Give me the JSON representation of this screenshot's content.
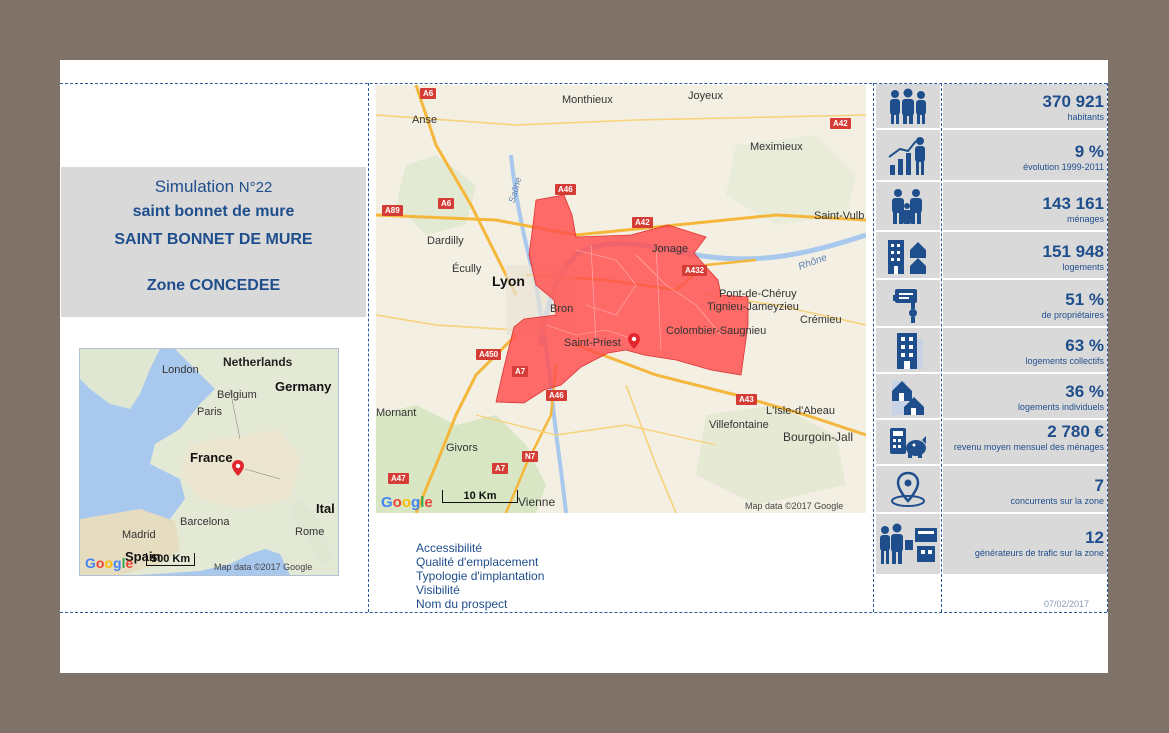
{
  "simulation": {
    "title_prefix": "Simulation ",
    "number": "N°22",
    "commune_lower": "saint bonnet de mure",
    "commune_upper": "SAINT BONNET DE MURE",
    "zone": "Zone CONCEDEE"
  },
  "mini_map": {
    "labels": [
      "Netherlands",
      "London",
      "Germany",
      "Belgium",
      "Paris",
      "France",
      "Barcelona",
      "Madrid",
      "Rome",
      "Ital",
      "Spain"
    ],
    "scale": "500 Km",
    "google": "Google",
    "attribution": "Map data ©2017 Google"
  },
  "main_map": {
    "places": [
      "Monthieux",
      "Joyeux",
      "Anse",
      "Meximieux",
      "Saint-Vulb",
      "Dardilly",
      "Écully",
      "Lyon",
      "Jonage",
      "Pont-de-Chéruy",
      "Tignieu-Jameyzieu",
      "Crémieu",
      "Colombier-Saugnieu",
      "Saint-Priest",
      "Bron",
      "Mornant",
      "L'Isle-d'Abeau",
      "Villefontaine",
      "Bourgoin-Jall",
      "Givors",
      "Vienne",
      "Saône",
      "Rhône"
    ],
    "roads": [
      "A6",
      "A42",
      "A46",
      "A89",
      "A6",
      "A42",
      "A432",
      "A450",
      "A7",
      "A46",
      "A43",
      "A47",
      "A7",
      "N7"
    ],
    "scale": "10 Km",
    "google": "Google",
    "attribution": "Map data ©2017 Google",
    "colors": {
      "zone_fill": "#ff4d4d",
      "water": "#a9c8ee",
      "highway": "#f5b73b"
    }
  },
  "factors": [
    "Accessibilité",
    "Qualité d'emplacement",
    "Typologie d'implantation",
    "Visibilité",
    "Nom du prospect"
  ],
  "stats": [
    {
      "icon": "population-icon",
      "value": "370 921",
      "label": "habitants"
    },
    {
      "icon": "growth-icon",
      "value": "9 %",
      "label": "évolution 1999-2011"
    },
    {
      "icon": "family-icon",
      "value": "143 161",
      "label": "ménages"
    },
    {
      "icon": "buildings-icon",
      "value": "151 948",
      "label": "logements"
    },
    {
      "icon": "owner-icon",
      "value": "51 %",
      "label": "de propriétaires"
    },
    {
      "icon": "apartment-icon",
      "value": "63 %",
      "label": "logements collectifs"
    },
    {
      "icon": "house-icon",
      "value": "36 %",
      "label": "logements individuels"
    },
    {
      "icon": "income-icon",
      "value": "2 780 €",
      "label": "revenu moyen mensuel des ménages"
    },
    {
      "icon": "location-icon",
      "value": "7",
      "label": "concurrents sur la zone"
    },
    {
      "icon": "traffic-icon",
      "value": "12",
      "label": "générateurs de trafic sur la zone"
    }
  ],
  "date": "07/02/2017",
  "colors": {
    "frame": "#7f7369",
    "panel": "#d9d9d9",
    "text_blue": "#1f4e8c"
  }
}
